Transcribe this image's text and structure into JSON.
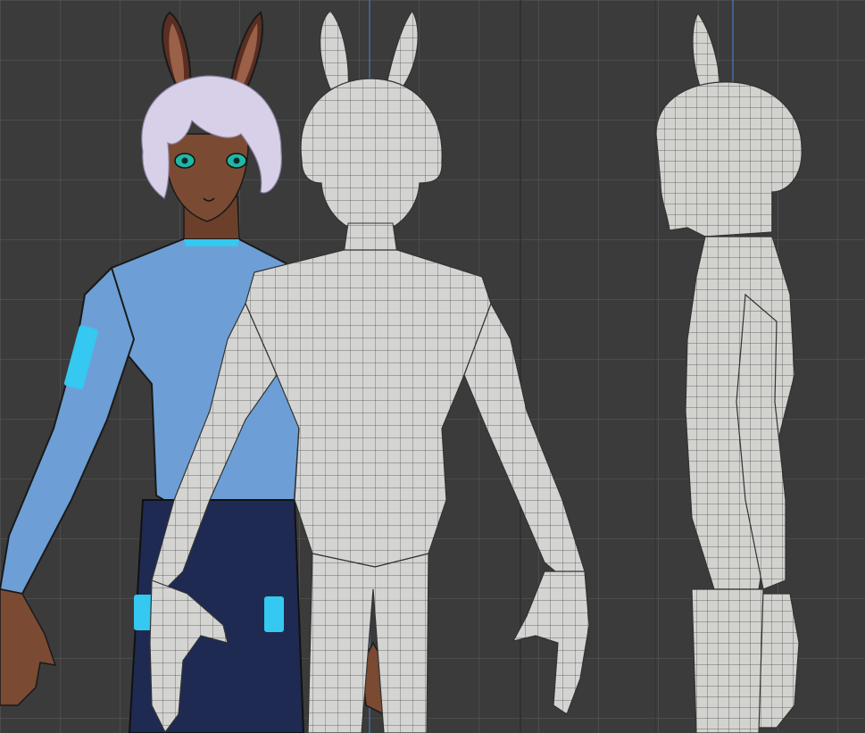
{
  "viewport": {
    "kind": "3d-modeling-viewport",
    "grid_visible": true,
    "views": [
      "front",
      "side"
    ]
  },
  "subjects": [
    {
      "name": "reference-drawing",
      "description_visible": false
    },
    {
      "name": "front-wireframe-mesh"
    },
    {
      "name": "side-wireframe-mesh"
    }
  ],
  "colors": {
    "background": "#3b3b3b",
    "grid_line": "#5a5a5a",
    "axis_line": "#4a7ab8",
    "mesh_fill": "#d4d4d2",
    "mesh_wire": "#3c3c3c",
    "shirt": "#6d9fd6",
    "pants": "#1e2a52",
    "skin": "#7a4a32",
    "hair": "#d8d0e8",
    "ear_inner": "#6a3a2a",
    "accent_cyan": "#35c8f0"
  }
}
